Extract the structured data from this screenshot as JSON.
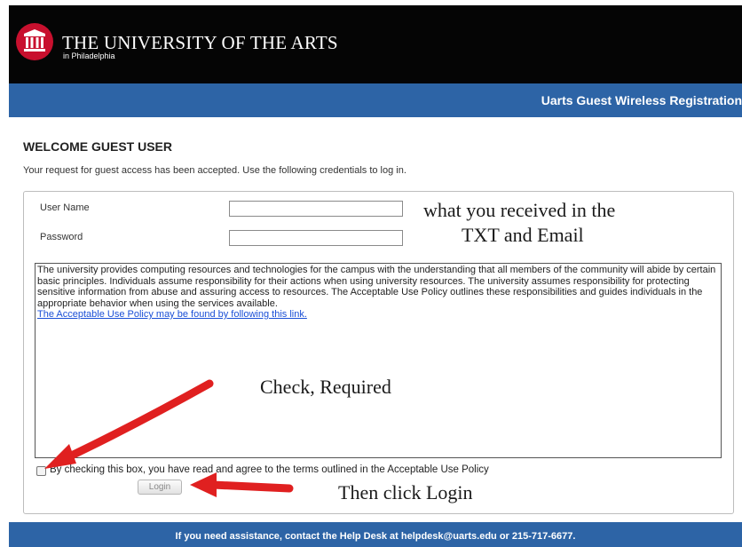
{
  "header": {
    "brand_name": "THE UNIVERSITY OF THE ARTS",
    "brand_sub": "in Philadelphia",
    "banner_title": "Uarts Guest Wireless Registration",
    "logo_icon": "columns-icon"
  },
  "main": {
    "heading": "WELCOME GUEST USER",
    "intro": "Your request for guest access has been accepted. Use the following credentials to log in.",
    "username_label": "User Name",
    "username_value": "",
    "password_label": "Password",
    "password_value": "",
    "policy_text": "The university provides computing resources and technologies for the campus with the understanding that all members of the community will abide by certain basic principles. Individuals assume responsibility for their actions when using university resources. The university assumes responsibility for protecting sensitive information from abuse and assuring access to resources. The Acceptable Use Policy outlines these responsibilities and guides individuals in the appropriate behavior when using the services available.",
    "policy_link": "The Acceptable Use Policy may be found by following this link.",
    "agree_label": "By checking this box, you have read and agree to the terms outlined in the Acceptable Use Policy",
    "agree_checked": false,
    "login_label": "Login"
  },
  "annotations": {
    "credentials_line1": "what you received in the",
    "credentials_line2": "TXT and Email",
    "check_note": "Check, Required",
    "login_note": "Then click Login",
    "arrow_color": "#e02020"
  },
  "footer": {
    "text": "If you need assistance, contact the Help Desk at helpdesk@uarts.edu or 215-717-6677."
  },
  "colors": {
    "header_bg": "#050505",
    "banner_bg": "#2d64a6",
    "logo_red": "#c8102e"
  }
}
